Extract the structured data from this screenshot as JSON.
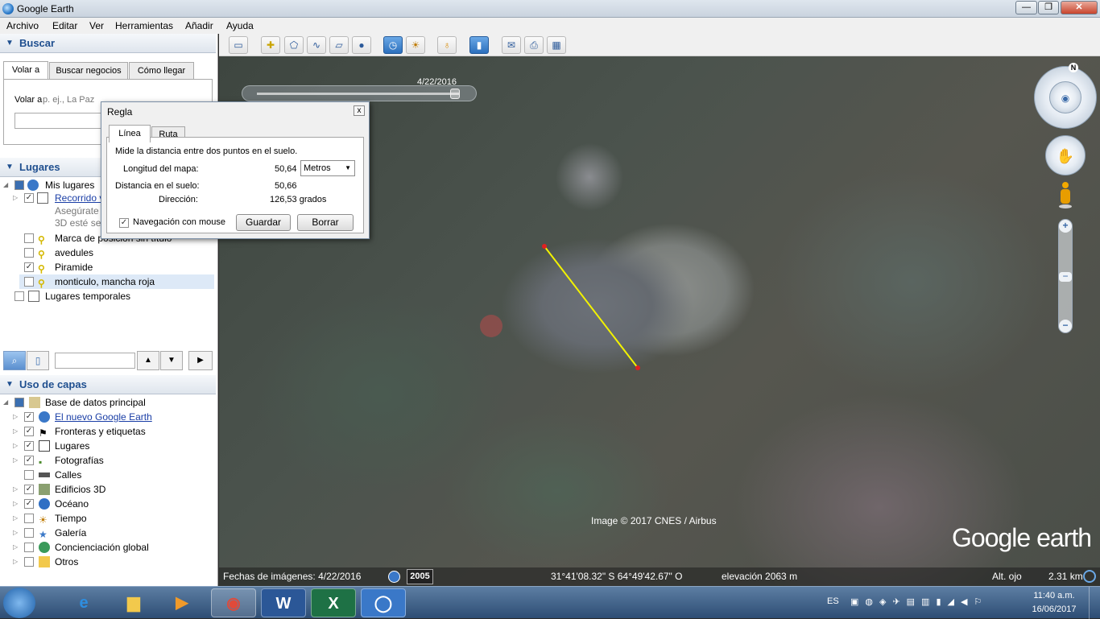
{
  "window": {
    "title": "Google Earth",
    "buttons": {
      "min": "—",
      "max": "❐",
      "close": "✕"
    }
  },
  "menu": [
    "Archivo",
    "Editar",
    "Ver",
    "Herramientas",
    "Añadir",
    "Ayuda"
  ],
  "toolbar": {
    "icons": [
      "sidebar-icon",
      "placemark-icon",
      "polygon-icon",
      "path-icon",
      "overlay-icon",
      "tour-icon",
      "history-icon",
      "sunlight-icon",
      "planets-icon",
      "ruler-icon",
      "email-icon",
      "print-icon",
      "maps-icon"
    ]
  },
  "search": {
    "header": "Buscar",
    "tabs": [
      "Volar a",
      "Buscar negocios",
      "Cómo llegar"
    ],
    "fly_label": "Volar a",
    "fly_hint": "p. ej., La Paz"
  },
  "places": {
    "header": "Lugares",
    "items": [
      {
        "label": "Mis lugares",
        "checked": "✓"
      },
      {
        "label": "Recorrido v",
        "checked": "✓"
      },
      {
        "label": "Asegúrate"
      },
      {
        "label": "3D esté sele"
      },
      {
        "label": "Marca de posición sin título",
        "checked": ""
      },
      {
        "label": "avedules",
        "checked": ""
      },
      {
        "label": "Piramide",
        "checked": "✓"
      },
      {
        "label": "monticulo, mancha roja",
        "checked": ""
      },
      {
        "label": "Lugares temporales",
        "checked": ""
      }
    ]
  },
  "layers": {
    "header": "Uso de capas",
    "items": [
      {
        "label": "Base de datos principal",
        "checked": "✓"
      },
      {
        "label": "El nuevo Google Earth",
        "checked": "✓"
      },
      {
        "label": "Fronteras y etiquetas",
        "checked": "✓"
      },
      {
        "label": "Lugares",
        "checked": "✓"
      },
      {
        "label": "Fotografías",
        "checked": "✓"
      },
      {
        "label": "Calles",
        "checked": ""
      },
      {
        "label": "Edificios 3D",
        "checked": "✓"
      },
      {
        "label": "Océano",
        "checked": "✓"
      },
      {
        "label": "Tiempo",
        "checked": ""
      },
      {
        "label": "Galería",
        "checked": ""
      },
      {
        "label": "Concienciación global",
        "checked": ""
      },
      {
        "label": "Otros",
        "checked": ""
      }
    ]
  },
  "ruler": {
    "title": "Regla",
    "close": "x",
    "tabs": [
      "Línea",
      "Ruta"
    ],
    "description": "Mide la distancia entre dos puntos en el suelo.",
    "map_length_label": "Longitud del mapa:",
    "map_length_value": "50,64",
    "unit": "Metros",
    "ground_label": "Distancia en el suelo:",
    "ground_value": "50,66",
    "direction_label": "Dirección:",
    "direction_value": "126,53 grados",
    "mouse_nav_label": "Navegación con mouse",
    "mouse_nav_checked": "✓",
    "save": "Guardar",
    "clear": "Borrar"
  },
  "map": {
    "time_slider_date": "4/22/2016",
    "copyright": "Image © 2017 CNES / Airbus",
    "brand": "Google earth",
    "north": "N"
  },
  "status": {
    "imagery_date": "Fechas de imágenes: 4/22/2016",
    "history_year": "2005",
    "coords": "31°41'08.32\" S   64°49'42.67\" O",
    "elevation": "elevación  2063 m",
    "eye_alt_label": "Alt. ojo",
    "eye_alt_value": "2.31 km"
  },
  "taskbar": {
    "apps": [
      "ie",
      "explorer",
      "media",
      "chrome",
      "word",
      "excel",
      "google-earth"
    ],
    "lang": "ES",
    "time": "11:40 a.m.",
    "date": "16/06/2017"
  }
}
